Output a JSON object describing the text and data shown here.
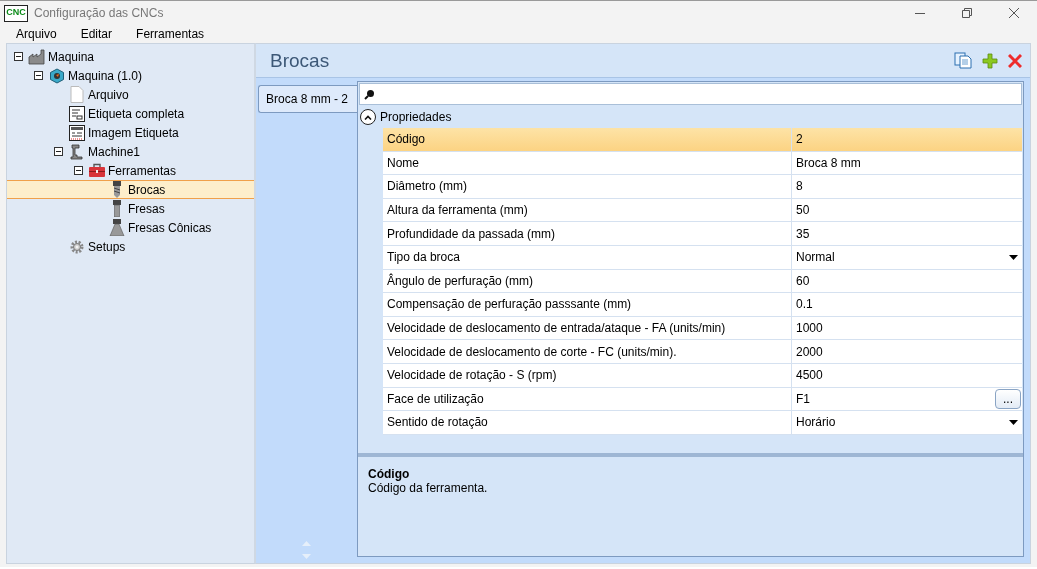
{
  "window": {
    "logo": "CNC",
    "title": "Configuração das CNCs"
  },
  "menu": [
    "Arquivo",
    "Editar",
    "Ferramentas"
  ],
  "tree": [
    {
      "label": "Maquina",
      "kind": "factory",
      "selected": false,
      "expanded": true,
      "children": [
        {
          "label": "Maquina (1.0)",
          "kind": "cube",
          "selected": false,
          "expanded": true,
          "children": [
            {
              "label": "Arquivo",
              "kind": "document",
              "selected": false
            },
            {
              "label": "Etiqueta completa",
              "kind": "form",
              "selected": false
            },
            {
              "label": "Imagem Etiqueta",
              "kind": "image-form",
              "selected": false
            },
            {
              "label": "Machine1",
              "kind": "machine",
              "selected": false,
              "expanded": true,
              "children": [
                {
                  "label": "Ferramentas",
                  "kind": "toolbox",
                  "selected": false,
                  "expanded": true,
                  "children": [
                    {
                      "label": "Brocas",
                      "kind": "drill",
                      "selected": true
                    },
                    {
                      "label": "Fresas",
                      "kind": "mill",
                      "selected": false
                    },
                    {
                      "label": "Fresas Cônicas",
                      "kind": "tapered-mill",
                      "selected": false
                    }
                  ]
                }
              ]
            },
            {
              "label": "Setups",
              "kind": "gear",
              "selected": false
            }
          ]
        }
      ]
    }
  ],
  "panel": {
    "title": "Brocas"
  },
  "tabs": [
    {
      "label": "Broca 8 mm - 2",
      "selected": true
    }
  ],
  "grid": {
    "category": {
      "label": "Propriedades",
      "expanded": true
    },
    "rows": [
      {
        "name": "Código",
        "value": "2",
        "kind": "text",
        "selected": true
      },
      {
        "name": "Nome",
        "value": "Broca 8 mm",
        "kind": "text",
        "selected": false
      },
      {
        "name": "Diâmetro (mm)",
        "value": "8",
        "kind": "text",
        "selected": false
      },
      {
        "name": "Altura da ferramenta (mm)",
        "value": "50",
        "kind": "text",
        "selected": false
      },
      {
        "name": "Profundidade da passada (mm)",
        "value": "35",
        "kind": "text",
        "selected": false
      },
      {
        "name": "Tipo da broca",
        "value": "Normal",
        "kind": "dropdown",
        "selected": false
      },
      {
        "name": "Ângulo de perfuração (mm)",
        "value": "60",
        "kind": "text",
        "selected": false
      },
      {
        "name": "Compensação de perfuração passsante (mm)",
        "value": "0.1",
        "kind": "text",
        "selected": false
      },
      {
        "name": "Velocidade de deslocamento de entrada/ataque - FA (units/min)",
        "value": "1000",
        "kind": "text",
        "selected": false
      },
      {
        "name": "Velocidade de deslocamento de corte - FC (units/min).",
        "value": "2000",
        "kind": "text",
        "selected": false
      },
      {
        "name": "Velocidade de rotação - S (rpm)",
        "value": "4500",
        "kind": "text",
        "selected": false
      },
      {
        "name": "Face de utilização",
        "value": "F1",
        "kind": "button",
        "button_text": "...",
        "selected": false
      },
      {
        "name": "Sentido de rotação",
        "value": "Horário",
        "kind": "dropdown",
        "selected": false
      }
    ]
  },
  "description": {
    "title": "Código",
    "text": "Código da ferramenta."
  }
}
